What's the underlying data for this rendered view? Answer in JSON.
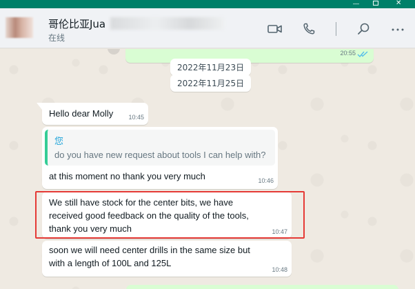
{
  "window": {
    "controls": {
      "minimize": "—",
      "close": "✕"
    }
  },
  "header": {
    "contact_name": "哥伦比亚Jua",
    "status": "在线",
    "icons": [
      "video-icon",
      "phone-icon",
      "search-icon",
      "more-icon"
    ]
  },
  "chat": {
    "outgoing_top": {
      "time": "20:55",
      "read": true
    },
    "dates": [
      "2022年11月23日",
      "2022年11月25日"
    ],
    "messages": [
      {
        "text": "Hello dear Molly",
        "time": "10:45"
      },
      {
        "quote": {
          "author": "您",
          "text": "do you have new request about tools I can help with?"
        },
        "text": "at this moment no thank you very much",
        "time": "10:46"
      },
      {
        "lines": [
          "We still have stock for the center bits, we have",
          "received good feedback on the quality of the tools,",
          "thank you very much"
        ],
        "time": "10:47",
        "highlighted": true
      },
      {
        "lines": [
          "soon we will need center drills in the same size but",
          "with a length of 100L and 125L"
        ],
        "time": "10:48"
      }
    ]
  },
  "colors": {
    "brand": "#008069",
    "incoming_bubble": "#ffffff",
    "outgoing_bubble": "#d9fdd3",
    "highlight": "#e53935",
    "quote_bar": "#35cd96",
    "read_ticks": "#53bdeb"
  }
}
